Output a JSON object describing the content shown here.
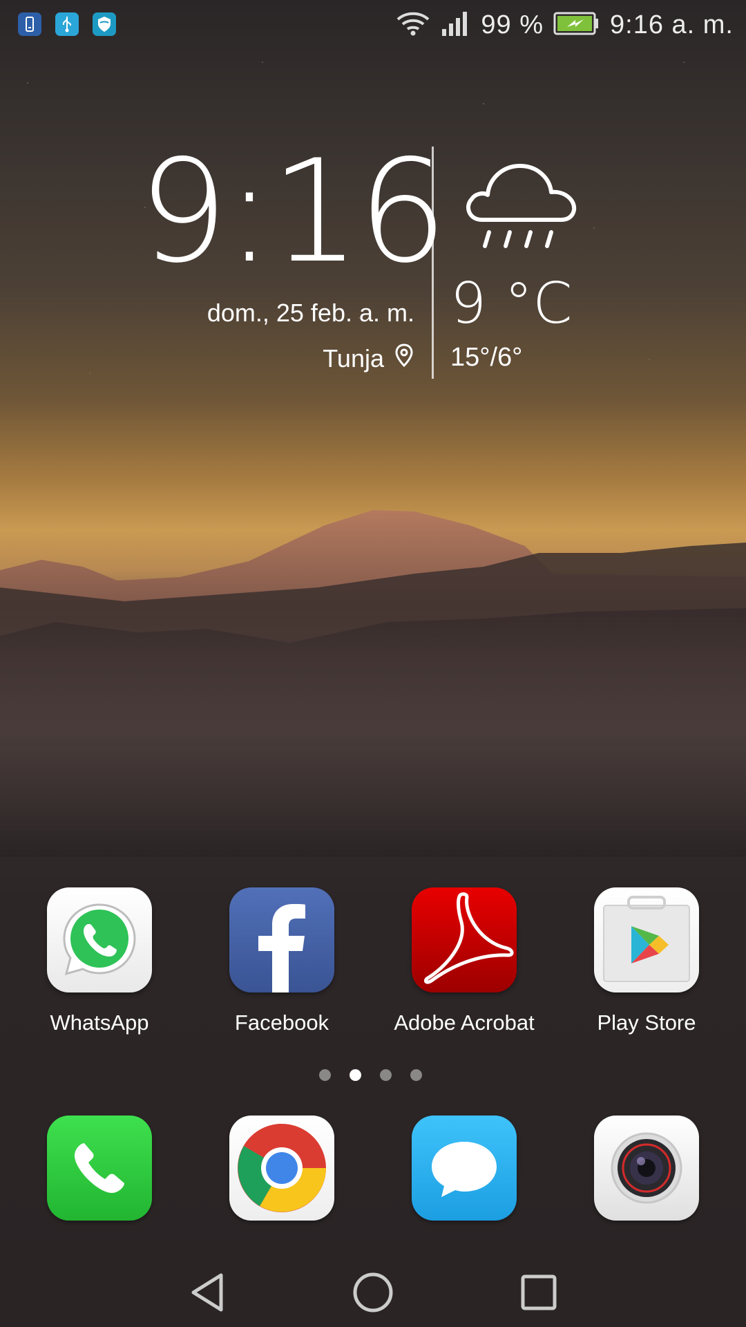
{
  "status_bar": {
    "notifications": [
      "screen-rotation-icon",
      "usb-icon",
      "shield-icon"
    ],
    "battery_percent": "99 %",
    "time": "9:16 a. m."
  },
  "clock_widget": {
    "time": "9:16",
    "date": "dom., 25 feb. a. m.",
    "location": "Tunja"
  },
  "weather_widget": {
    "icon": "rain-cloud-icon",
    "temperature": "9 °C",
    "range": "15°/6°"
  },
  "apps": [
    {
      "label": "WhatsApp",
      "icon": "whatsapp-icon"
    },
    {
      "label": "Facebook",
      "icon": "facebook-icon"
    },
    {
      "label": "Adobe Acrobat",
      "icon": "adobe-acrobat-icon"
    },
    {
      "label": "Play Store",
      "icon": "play-store-icon"
    }
  ],
  "page_indicator": {
    "pages": 4,
    "current": 2
  },
  "dock": [
    {
      "icon": "phone-icon",
      "color": "#2dcc3f"
    },
    {
      "icon": "chrome-icon",
      "color": "#ffffff"
    },
    {
      "icon": "messages-icon",
      "color": "#2aaef0"
    },
    {
      "icon": "camera-icon",
      "color": "#f4f4f4"
    }
  ],
  "navigation": [
    "back-icon",
    "home-icon",
    "recents-icon"
  ],
  "colors": {
    "whatsapp": "#25d366",
    "facebook": "#3b5998",
    "acrobat": "#d40000",
    "battery": "#7fc13b"
  }
}
